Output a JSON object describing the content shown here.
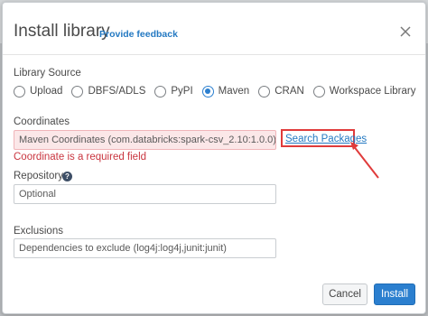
{
  "dialog": {
    "title": "Install library",
    "feedback_link": "Provide feedback"
  },
  "library_source": {
    "label": "Library Source",
    "options": [
      "Upload",
      "DBFS/ADLS",
      "PyPI",
      "Maven",
      "CRAN",
      "Workspace Library"
    ],
    "selected": "Maven"
  },
  "coordinates": {
    "label": "Coordinates",
    "placeholder": "Maven Coordinates (com.databricks:spark-csv_2.10:1.0.0)",
    "error": "Coordinate is a required field",
    "search_link": "Search Packages"
  },
  "repository": {
    "label": "Repository",
    "placeholder": "Optional"
  },
  "exclusions": {
    "label": "Exclusions",
    "placeholder": "Dependencies to exclude (log4j:log4j,junit:junit)"
  },
  "footer": {
    "cancel_label": "Cancel",
    "install_label": "Install"
  },
  "colors": {
    "accent": "#2b7fcf",
    "error": "#c9353f",
    "highlight": "#e03b3b"
  },
  "icons": [
    "close-icon",
    "help-icon",
    "annotation-arrow"
  ]
}
